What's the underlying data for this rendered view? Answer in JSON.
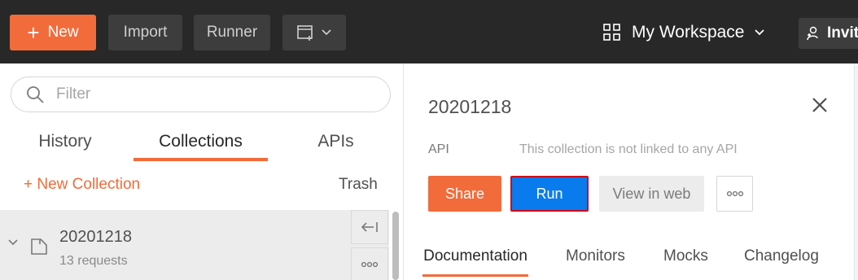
{
  "header": {
    "new_label": "New",
    "import_label": "Import",
    "runner_label": "Runner",
    "workspace_label": "My Workspace",
    "invite_label": "Invit"
  },
  "sidebar": {
    "filter_placeholder": "Filter",
    "tabs": [
      {
        "label": "History"
      },
      {
        "label": "Collections"
      },
      {
        "label": "APIs"
      }
    ],
    "new_collection_label": "+ New Collection",
    "trash_label": "Trash",
    "collections": [
      {
        "name": "20201218",
        "count": "13 requests"
      }
    ]
  },
  "panel": {
    "title": "20201218",
    "api_label": "API",
    "api_status": "This collection is not linked to any API",
    "share_label": "Share",
    "run_label": "Run",
    "view_label": "View in web",
    "tabs": [
      {
        "label": "Documentation"
      },
      {
        "label": "Monitors"
      },
      {
        "label": "Mocks"
      },
      {
        "label": "Changelog"
      }
    ]
  },
  "colors": {
    "accent": "#f26b3a",
    "run_button": "#097bed",
    "topbar": "#282828"
  }
}
